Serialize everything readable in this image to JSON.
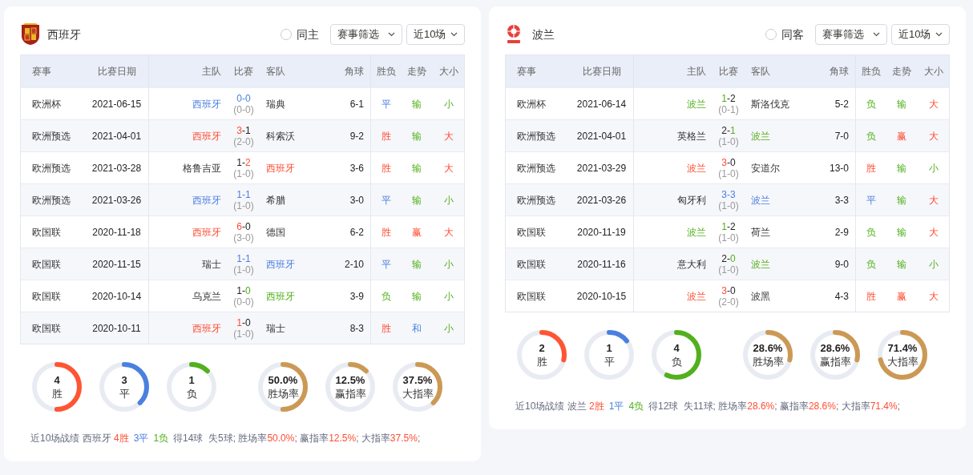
{
  "panels": [
    {
      "team": "西班牙",
      "logo": {
        "kind": "crest"
      },
      "filter_label": "同主",
      "filter_checked": false,
      "dropdowns": [
        "赛事筛选",
        "近10场"
      ],
      "columns": [
        "赛事",
        "比赛日期",
        "主队",
        "比赛",
        "客队",
        "角球",
        "胜负",
        "走势",
        "大小"
      ],
      "rows": [
        {
          "kind": "draw",
          "competition": "欧洲杯",
          "date": "2021-06-15",
          "home": {
            "name": "西班牙",
            "highlighted": true
          },
          "score": "0-0",
          "half_time": "(0-0)",
          "away": {
            "name": "瑞典",
            "highlighted": false
          },
          "corners": "6-1",
          "result_label": "平",
          "trend": {
            "text": "输",
            "kind": "loss"
          },
          "size": {
            "text": "小",
            "kind": "under"
          }
        },
        {
          "kind": "win",
          "competition": "欧洲预选",
          "date": "2021-04-01",
          "home": {
            "name": "西班牙",
            "highlighted": true
          },
          "score": "3-1",
          "half_time": "(2-0)",
          "away": {
            "name": "科索沃",
            "highlighted": false
          },
          "corners": "9-2",
          "result_label": "胜",
          "trend": {
            "text": "输",
            "kind": "loss"
          },
          "size": {
            "text": "大",
            "kind": "over"
          }
        },
        {
          "kind": "win",
          "competition": "欧洲预选",
          "date": "2021-03-28",
          "home": {
            "name": "格鲁吉亚",
            "highlighted": false
          },
          "score": "1-2",
          "half_time": "(1-0)",
          "away": {
            "name": "西班牙",
            "highlighted": true
          },
          "corners": "3-6",
          "result_label": "胜",
          "trend": {
            "text": "输",
            "kind": "loss"
          },
          "size": {
            "text": "大",
            "kind": "over"
          }
        },
        {
          "kind": "draw",
          "competition": "欧洲预选",
          "date": "2021-03-26",
          "home": {
            "name": "西班牙",
            "highlighted": true
          },
          "score": "1-1",
          "half_time": "(1-0)",
          "away": {
            "name": "希腊",
            "highlighted": false
          },
          "corners": "3-0",
          "result_label": "平",
          "trend": {
            "text": "输",
            "kind": "loss"
          },
          "size": {
            "text": "小",
            "kind": "under"
          }
        },
        {
          "kind": "win",
          "competition": "欧国联",
          "date": "2020-11-18",
          "home": {
            "name": "西班牙",
            "highlighted": true
          },
          "score": "6-0",
          "half_time": "(3-0)",
          "away": {
            "name": "德国",
            "highlighted": false
          },
          "corners": "6-2",
          "result_label": "胜",
          "trend": {
            "text": "赢",
            "kind": "win"
          },
          "size": {
            "text": "大",
            "kind": "over"
          }
        },
        {
          "kind": "draw",
          "competition": "欧国联",
          "date": "2020-11-15",
          "home": {
            "name": "瑞士",
            "highlighted": false
          },
          "score": "1-1",
          "half_time": "(1-0)",
          "away": {
            "name": "西班牙",
            "highlighted": true
          },
          "corners": "2-10",
          "result_label": "平",
          "trend": {
            "text": "输",
            "kind": "loss"
          },
          "size": {
            "text": "小",
            "kind": "under"
          }
        },
        {
          "kind": "loss",
          "competition": "欧国联",
          "date": "2020-10-14",
          "home": {
            "name": "乌克兰",
            "highlighted": false
          },
          "score": "1-0",
          "half_time": "(0-0)",
          "away": {
            "name": "西班牙",
            "highlighted": true
          },
          "corners": "3-9",
          "result_label": "负",
          "trend": {
            "text": "输",
            "kind": "loss"
          },
          "size": {
            "text": "小",
            "kind": "under"
          }
        },
        {
          "kind": "win",
          "competition": "欧国联",
          "date": "2020-10-11",
          "home": {
            "name": "西班牙",
            "highlighted": true
          },
          "score": "1-0",
          "half_time": "(1-0)",
          "away": {
            "name": "瑞士",
            "highlighted": false
          },
          "corners": "8-3",
          "result_label": "胜",
          "trend": {
            "text": "和",
            "kind": "draw"
          },
          "size": {
            "text": "小",
            "kind": "under"
          }
        }
      ],
      "rings": [
        {
          "value": "4",
          "label": "胜",
          "kind": "win",
          "level": 0.5
        },
        {
          "value": "3",
          "label": "平",
          "kind": "draw",
          "level": 0.375
        },
        {
          "value": "1",
          "label": "负",
          "kind": "loss",
          "level": 0.125
        },
        {
          "value": "50.0%",
          "label": "胜场率",
          "kind": "rate",
          "level": 0.5
        },
        {
          "value": "12.5%",
          "label": "赢指率",
          "kind": "rate",
          "level": 0.125
        },
        {
          "value": "37.5%",
          "label": "大指率",
          "kind": "rate",
          "level": 0.375
        }
      ],
      "summary": [
        {
          "text": "近10场战绩 西班牙 ",
          "kind": "plain"
        },
        {
          "text": "4胜",
          "kind": "win"
        },
        {
          "text": "3平",
          "kind": "draw"
        },
        {
          "text": "1负",
          "kind": "loss"
        },
        {
          "text": "得14球  失5球; 胜场率",
          "kind": "plain"
        },
        {
          "text": "50.0%",
          "kind": "rate"
        },
        {
          "text": "; 赢指率",
          "kind": "plain"
        },
        {
          "text": "12.5%",
          "kind": "rate"
        },
        {
          "text": "; 大指率",
          "kind": "plain"
        },
        {
          "text": "37.5%",
          "kind": "rate"
        },
        {
          "text": ";",
          "kind": "plain"
        }
      ]
    },
    {
      "team": "波兰",
      "logo": {
        "kind": "emblem"
      },
      "filter_label": "同客",
      "filter_checked": false,
      "dropdowns": [
        "赛事筛选",
        "近10场"
      ],
      "columns": [
        "赛事",
        "比赛日期",
        "主队",
        "比赛",
        "客队",
        "角球",
        "胜负",
        "走势",
        "大小"
      ],
      "rows": [
        {
          "kind": "loss",
          "competition": "欧洲杯",
          "date": "2021-06-14",
          "home": {
            "name": "波兰",
            "highlighted": true
          },
          "score": "1-2",
          "half_time": "(0-1)",
          "away": {
            "name": "斯洛伐克",
            "highlighted": false
          },
          "corners": "5-2",
          "result_label": "负",
          "trend": {
            "text": "输",
            "kind": "loss"
          },
          "size": {
            "text": "大",
            "kind": "over"
          }
        },
        {
          "kind": "loss",
          "competition": "欧洲预选",
          "date": "2021-04-01",
          "home": {
            "name": "英格兰",
            "highlighted": false
          },
          "score": "2-1",
          "half_time": "(1-0)",
          "away": {
            "name": "波兰",
            "highlighted": true
          },
          "corners": "7-0",
          "result_label": "负",
          "trend": {
            "text": "赢",
            "kind": "win"
          },
          "size": {
            "text": "大",
            "kind": "over"
          }
        },
        {
          "kind": "win",
          "competition": "欧洲预选",
          "date": "2021-03-29",
          "home": {
            "name": "波兰",
            "highlighted": true
          },
          "score": "3-0",
          "half_time": "(1-0)",
          "away": {
            "name": "安道尔",
            "highlighted": false
          },
          "corners": "13-0",
          "result_label": "胜",
          "trend": {
            "text": "输",
            "kind": "loss"
          },
          "size": {
            "text": "小",
            "kind": "under"
          }
        },
        {
          "kind": "draw",
          "competition": "欧洲预选",
          "date": "2021-03-26",
          "home": {
            "name": "匈牙利",
            "highlighted": false
          },
          "score": "3-3",
          "half_time": "(1-0)",
          "away": {
            "name": "波兰",
            "highlighted": true
          },
          "corners": "3-3",
          "result_label": "平",
          "trend": {
            "text": "输",
            "kind": "loss"
          },
          "size": {
            "text": "大",
            "kind": "over"
          }
        },
        {
          "kind": "loss",
          "competition": "欧国联",
          "date": "2020-11-19",
          "home": {
            "name": "波兰",
            "highlighted": true
          },
          "score": "1-2",
          "half_time": "(1-0)",
          "away": {
            "name": "荷兰",
            "highlighted": false
          },
          "corners": "2-9",
          "result_label": "负",
          "trend": {
            "text": "输",
            "kind": "loss"
          },
          "size": {
            "text": "大",
            "kind": "over"
          }
        },
        {
          "kind": "loss",
          "competition": "欧国联",
          "date": "2020-11-16",
          "home": {
            "name": "意大利",
            "highlighted": false
          },
          "score": "2-0",
          "half_time": "(1-0)",
          "away": {
            "name": "波兰",
            "highlighted": true
          },
          "corners": "9-0",
          "result_label": "负",
          "trend": {
            "text": "输",
            "kind": "loss"
          },
          "size": {
            "text": "小",
            "kind": "under"
          }
        },
        {
          "kind": "win",
          "competition": "欧国联",
          "date": "2020-10-15",
          "home": {
            "name": "波兰",
            "highlighted": true
          },
          "score": "3-0",
          "half_time": "(2-0)",
          "away": {
            "name": "波黑",
            "highlighted": false
          },
          "corners": "4-3",
          "result_label": "胜",
          "trend": {
            "text": "赢",
            "kind": "win"
          },
          "size": {
            "text": "大",
            "kind": "over"
          }
        }
      ],
      "rings": [
        {
          "value": "2",
          "label": "胜",
          "kind": "win",
          "level": 0.286
        },
        {
          "value": "1",
          "label": "平",
          "kind": "draw",
          "level": 0.143
        },
        {
          "value": "4",
          "label": "负",
          "kind": "loss",
          "level": 0.571
        },
        {
          "value": "28.6%",
          "label": "胜场率",
          "kind": "rate",
          "level": 0.286
        },
        {
          "value": "28.6%",
          "label": "赢指率",
          "kind": "rate",
          "level": 0.286
        },
        {
          "value": "71.4%",
          "label": "大指率",
          "kind": "rate",
          "level": 0.714
        }
      ],
      "summary": [
        {
          "text": "近10场战绩 波兰 ",
          "kind": "plain"
        },
        {
          "text": "2胜",
          "kind": "win"
        },
        {
          "text": "1平",
          "kind": "draw"
        },
        {
          "text": "4负",
          "kind": "loss"
        },
        {
          "text": "得12球  失11球; 胜场率",
          "kind": "plain"
        },
        {
          "text": "28.6%",
          "kind": "rate"
        },
        {
          "text": "; 赢指率",
          "kind": "plain"
        },
        {
          "text": "28.6%",
          "kind": "rate"
        },
        {
          "text": "; 大指率",
          "kind": "plain"
        },
        {
          "text": "71.4%",
          "kind": "rate"
        },
        {
          "text": ";",
          "kind": "plain"
        }
      ]
    }
  ]
}
